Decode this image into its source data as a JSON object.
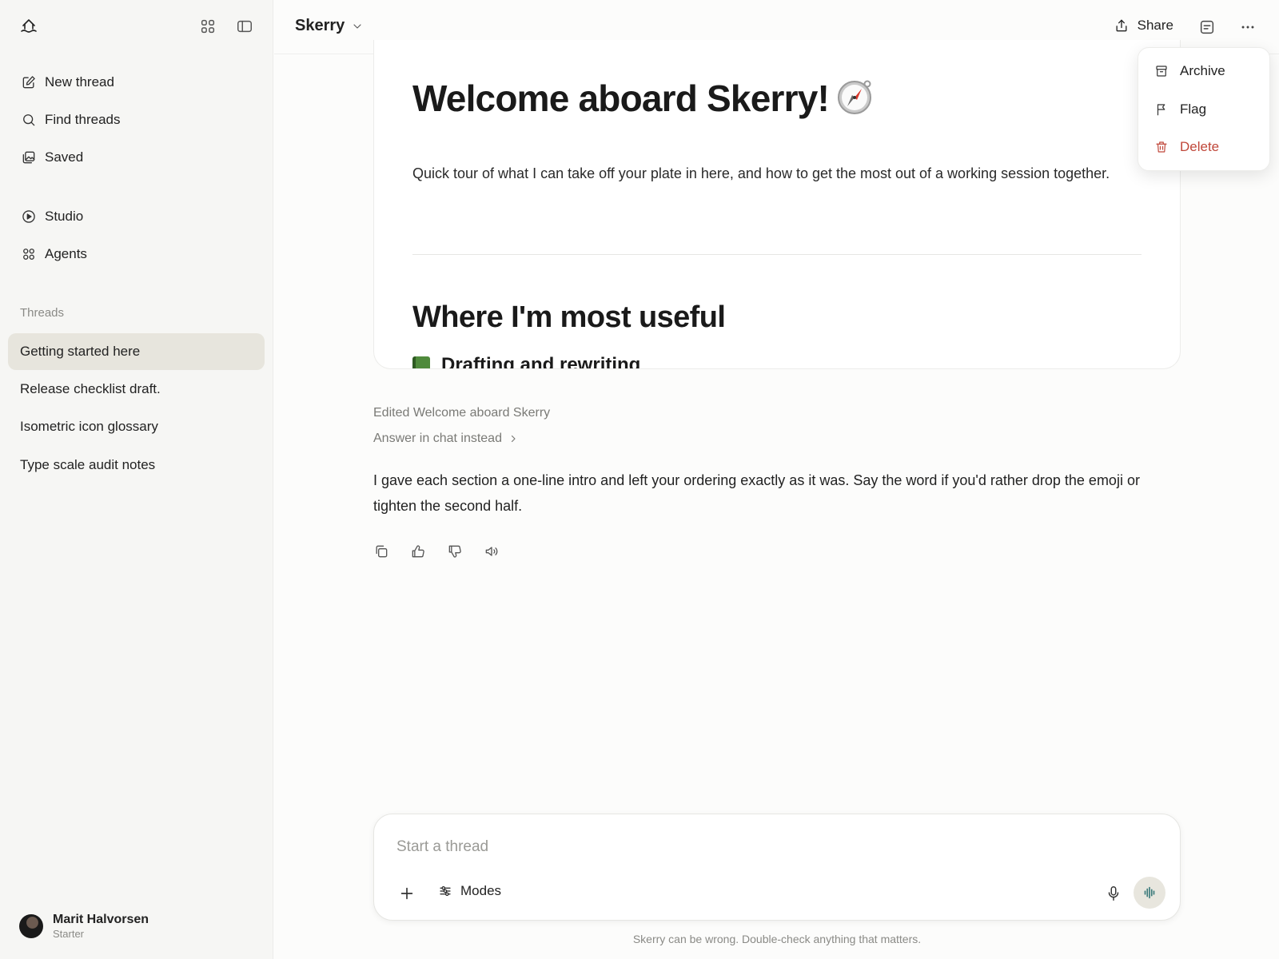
{
  "sidebar": {
    "nav": [
      {
        "label": "New thread",
        "icon": "edit-icon"
      },
      {
        "label": "Find threads",
        "icon": "search-icon"
      },
      {
        "label": "Saved",
        "icon": "images-icon"
      },
      {
        "label": "Studio",
        "icon": "play-circle-icon"
      },
      {
        "label": "Agents",
        "icon": "grid-icon"
      }
    ],
    "threads_heading": "Threads",
    "threads": [
      {
        "label": "Getting started here",
        "active": true
      },
      {
        "label": "Release checklist draft.",
        "active": false
      },
      {
        "label": "Isometric icon glossary",
        "active": false
      },
      {
        "label": "Type scale audit notes",
        "active": false
      }
    ],
    "user": {
      "name": "Marit Halvorsen",
      "plan": "Starter"
    }
  },
  "header": {
    "title": "Skerry",
    "share_label": "Share"
  },
  "document": {
    "h1": "Welcome aboard Skerry!",
    "intro": "Quick tour of what I can take off your plate in here, and how to get the most out of a working session together.",
    "h2": "Where I'm most useful",
    "h3": "Drafting and rewriting"
  },
  "message": {
    "edited_label": "Edited Welcome aboard Skerry",
    "answer_link": "Answer in chat instead",
    "body": "I gave each section a one-line intro and left your ordering exactly as it was. Say the word if you'd rather drop the emoji or tighten the second half."
  },
  "composer": {
    "placeholder": "Start a thread",
    "value": "",
    "modes_label": "Modes"
  },
  "footnote": "Skerry can be wrong. Double-check anything that matters.",
  "menu": {
    "items": [
      {
        "label": "Archive",
        "icon": "archive-icon"
      },
      {
        "label": "Flag",
        "icon": "flag-icon"
      },
      {
        "label": "Delete",
        "icon": "trash-icon",
        "danger": true
      }
    ]
  },
  "colors": {
    "sidebar_bg": "#f6f6f4",
    "active_thread_bg": "#e7e5dd",
    "danger": "#c0473a",
    "voice_button_bg": "#e8e6de",
    "voice_accent": "#3a7a7a"
  }
}
